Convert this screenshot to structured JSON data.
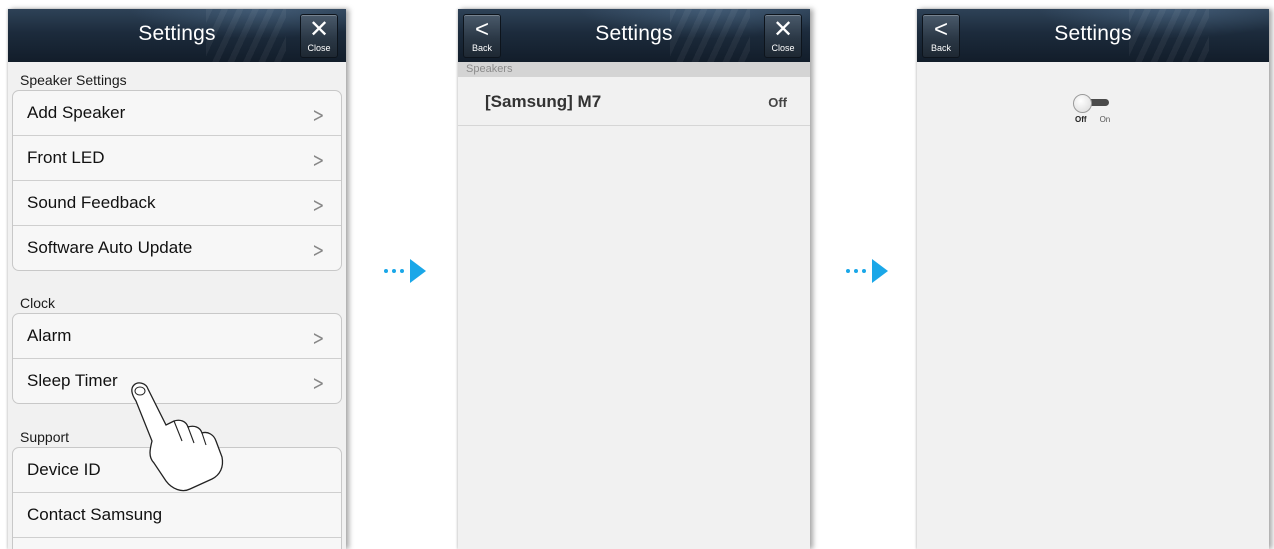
{
  "screen1": {
    "title": "Settings",
    "close_label": "Close",
    "sections": [
      {
        "label": "Speaker Settings",
        "items": [
          "Add Speaker",
          "Front LED",
          "Sound Feedback",
          "Software Auto Update"
        ]
      },
      {
        "label": "Clock",
        "items": [
          "Alarm",
          "Sleep Timer"
        ]
      },
      {
        "label": "Support",
        "items": [
          "Device ID",
          "Contact Samsung"
        ]
      }
    ]
  },
  "screen2": {
    "title": "Settings",
    "back_label": "Back",
    "close_label": "Close",
    "section_label": "Speakers",
    "speaker": {
      "name": "[Samsung] M7",
      "state": "Off"
    }
  },
  "screen3": {
    "title": "Settings",
    "back_label": "Back",
    "toggle": {
      "off_label": "Off",
      "on_label": "On",
      "value": "Off"
    }
  },
  "icons": {
    "close": "close-x-icon",
    "back": "chevron-left-icon",
    "row": "chevron-right-icon",
    "flow": "flow-arrow-icon",
    "gesture": "tap-hand-icon"
  },
  "colors": {
    "accent": "#1aa7e8",
    "navbar": "#1c2b3c"
  }
}
